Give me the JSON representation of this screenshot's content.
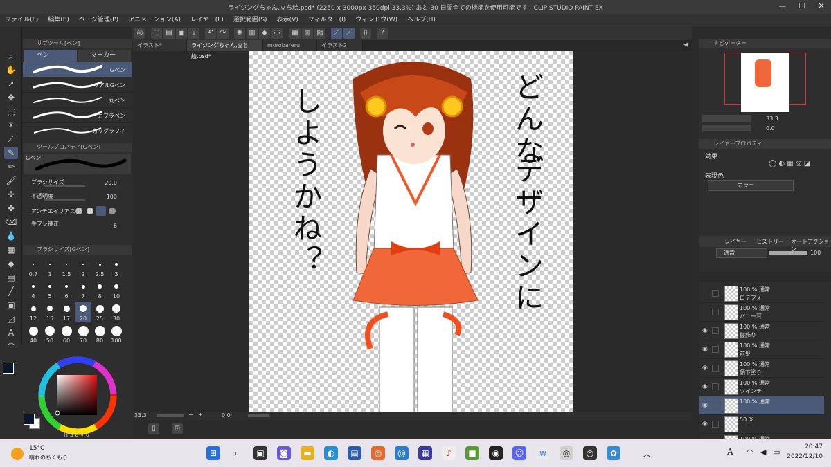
{
  "window": {
    "title": "ライジングちゃん,立ち絵.psd* (2250 x 3000px 350dpi 33.3%)  あと 30 日間全ての機能を使用可能です - CLIP STUDIO PAINT EX",
    "minimize": "—",
    "maximize": "☐",
    "close": "✕"
  },
  "menu": [
    "ファイル(F)",
    "編集(E)",
    "ページ管理(P)",
    "アニメーション(A)",
    "レイヤー(L)",
    "選択範囲(S)",
    "表示(V)",
    "フィルター(I)",
    "ウィンドウ(W)",
    "ヘルプ(H)"
  ],
  "subtool": {
    "header": "サブツール[ペン]",
    "tabs": [
      "ペン",
      "マーカー"
    ],
    "brushes": [
      "Gペン",
      "リアルGペン",
      "丸ペン",
      "カブラペン",
      "カリグラフィ"
    ]
  },
  "toolprop": {
    "header": "ツールプロパティ[Gペン]",
    "preview_label": "Gペン",
    "rows": [
      {
        "label": "ブラシサイズ",
        "value": "20.0"
      },
      {
        "label": "不透明度",
        "value": "100"
      },
      {
        "label": "アンチエイリアス",
        "value": ""
      },
      {
        "label": "手ブレ補正",
        "value": "6"
      }
    ]
  },
  "brushsize": {
    "header": "ブラシサイズ[Gペン]",
    "sizes": [
      "0.7",
      "1",
      "1.5",
      "2",
      "2.5",
      "3",
      "4",
      "5",
      "6",
      "7",
      "8",
      "10",
      "12",
      "15",
      "17",
      "20",
      "25",
      "30",
      "40",
      "50",
      "60",
      "70",
      "80",
      "100"
    ],
    "selected": "20"
  },
  "color": {
    "main": "#0a1530",
    "sub": "#ffffff",
    "status_items": [
      "H",
      "S",
      "0",
      "V",
      "0"
    ]
  },
  "doc_tabs": [
    {
      "label": "イラスト*",
      "active": false
    },
    {
      "label": "ライジングちゃん,立ち絵.psd*",
      "active": true
    },
    {
      "label": "morobareru",
      "active": false
    },
    {
      "label": "イラスト2",
      "active": false
    }
  ],
  "canvas_text": {
    "left_column": "しようかね？",
    "right_column_1": "どんな",
    "right_column_2": "デザインに"
  },
  "statusbar": {
    "zoom": "33.3",
    "angle": "0.0"
  },
  "navigator": {
    "header": "ナビゲーター",
    "zoom": "33.3",
    "angle": "0.0"
  },
  "layer_property": {
    "header": "レイヤープロパティ",
    "effect_label": "効果",
    "express_label": "表現色",
    "express_value": "カラー"
  },
  "layer_panel": {
    "tabs": [
      "レイヤー",
      "ヒストリー",
      "オートアクション"
    ],
    "blend_mode": "通常",
    "opacity": "100",
    "layers": [
      {
        "pct": "100 % 通常",
        "name": "ロデフォ",
        "visible": false
      },
      {
        "pct": "100 % 通常",
        "name": "バニー耳",
        "visible": false
      },
      {
        "pct": "100 % 通常",
        "name": "髪飾り",
        "visible": true
      },
      {
        "pct": "100 % 通常",
        "name": "前髪",
        "visible": true
      },
      {
        "pct": "100 % 通常",
        "name": "顔下塗り",
        "visible": true
      },
      {
        "pct": "100 % 通常",
        "name": "ツインテ",
        "visible": true
      },
      {
        "pct": "100 % 通常",
        "name": "",
        "visible": true,
        "selected": true
      },
      {
        "pct": "50 %",
        "name": "",
        "visible": true
      },
      {
        "pct": "100 % 通常",
        "name": "",
        "visible": false
      }
    ]
  },
  "taskbar": {
    "weather_temp": "15°C",
    "weather_desc": "晴れのちくもり",
    "time": "20:47",
    "date": "2022/12/10",
    "ime": "A"
  }
}
